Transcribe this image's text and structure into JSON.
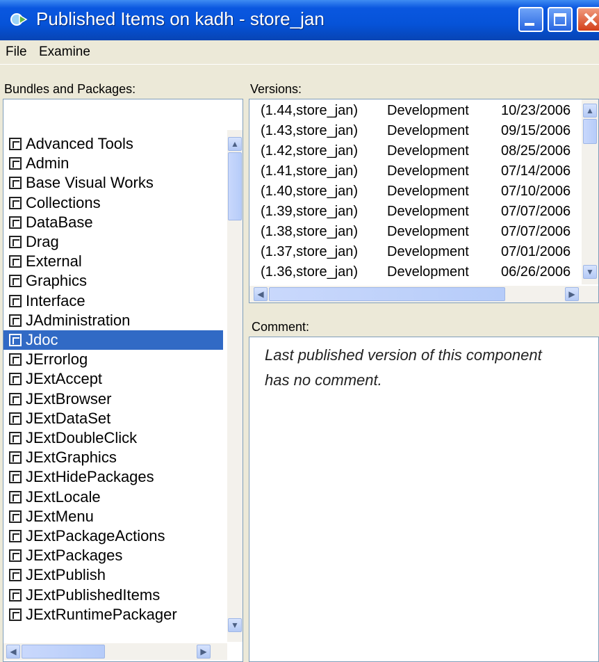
{
  "window": {
    "title": "Published Items on kadh - store_jan"
  },
  "menu": [
    "File",
    "Examine"
  ],
  "bundles": {
    "label": "Bundles and Packages:",
    "items": [
      "Advanced Tools",
      "Admin",
      "Base Visual Works",
      "Collections",
      "DataBase",
      "Drag",
      "External",
      "Graphics",
      "Interface",
      "JAdministration",
      "Jdoc",
      "JErrorlog",
      "JExtAccept",
      "JExtBrowser",
      "JExtDataSet",
      "JExtDoubleClick",
      "JExtGraphics",
      "JExtHidePackages",
      "JExtLocale",
      "JExtMenu",
      "JExtPackageActions",
      "JExtPackages",
      "JExtPublish",
      "JExtPublishedItems",
      "JExtRuntimePackager"
    ],
    "selected_index": 10
  },
  "versions": {
    "label": "Versions:",
    "rows": [
      {
        "version": "(1.44,store_jan)",
        "status": "Development",
        "date": "10/23/2006"
      },
      {
        "version": "(1.43,store_jan)",
        "status": "Development",
        "date": "09/15/2006"
      },
      {
        "version": "(1.42,store_jan)",
        "status": "Development",
        "date": "08/25/2006"
      },
      {
        "version": "(1.41,store_jan)",
        "status": "Development",
        "date": "07/14/2006"
      },
      {
        "version": "(1.40,store_jan)",
        "status": "Development",
        "date": "07/10/2006"
      },
      {
        "version": "(1.39,store_jan)",
        "status": "Development",
        "date": "07/07/2006"
      },
      {
        "version": "(1.38,store_jan)",
        "status": "Development",
        "date": "07/07/2006"
      },
      {
        "version": "(1.37,store_jan)",
        "status": "Development",
        "date": "07/01/2006"
      },
      {
        "version": "(1.36,store_jan)",
        "status": "Development",
        "date": "06/26/2006"
      }
    ]
  },
  "comment": {
    "label": "Comment:",
    "text": "Last published version of this component has no comment."
  },
  "colors": {
    "titlebar": "#0653D8",
    "selection": "#316AC5",
    "window_bg": "#ECE9D8"
  },
  "icons": {
    "app": "store-icon",
    "package": "package-icon"
  }
}
